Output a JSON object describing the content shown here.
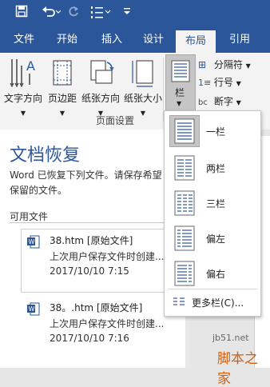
{
  "qat": {
    "save_icon": "save-icon",
    "undo_icon": "undo-icon",
    "redo_icon": "redo-icon",
    "list_icon": "numbered-list-icon"
  },
  "tabs": [
    "文件",
    "开始",
    "插入",
    "设计",
    "布局",
    "引用"
  ],
  "active_tab": "布局",
  "ribbon": {
    "text_direction": "文字方向",
    "margins": "页边距",
    "orientation": "纸张方向",
    "size": "纸张大小",
    "columns": "栏",
    "breaks": "分隔符",
    "line_numbers": "行号",
    "hyphenation": "断字",
    "hyphenation_prefix": "bc",
    "group_label": "页面设置"
  },
  "recovery": {
    "title": "文档恢复",
    "description": "Word 已恢复下列文件。请保存希望保留的文件。",
    "available_label": "可用文件",
    "files": [
      {
        "name": "38.htm  [原始文件]",
        "subtitle": "上次用户保存文件时创建...",
        "date": "2017/10/10 7:15"
      },
      {
        "name": "38。.htm  [原始文件]",
        "subtitle": "上次用户保存文件时创建...",
        "date": "2017/10/10 7:16"
      }
    ]
  },
  "columns_menu": {
    "items": [
      "一栏",
      "两栏",
      "三栏",
      "偏左",
      "偏右"
    ],
    "selected": "一栏",
    "more": "更多栏(C)..."
  },
  "watermark": {
    "site": "jb51.net",
    "brand": "脚本之家"
  },
  "colors": {
    "accent": "#2b579a",
    "ribbon_bg": "#f3f3f3",
    "selection": "#c5c5c5"
  }
}
